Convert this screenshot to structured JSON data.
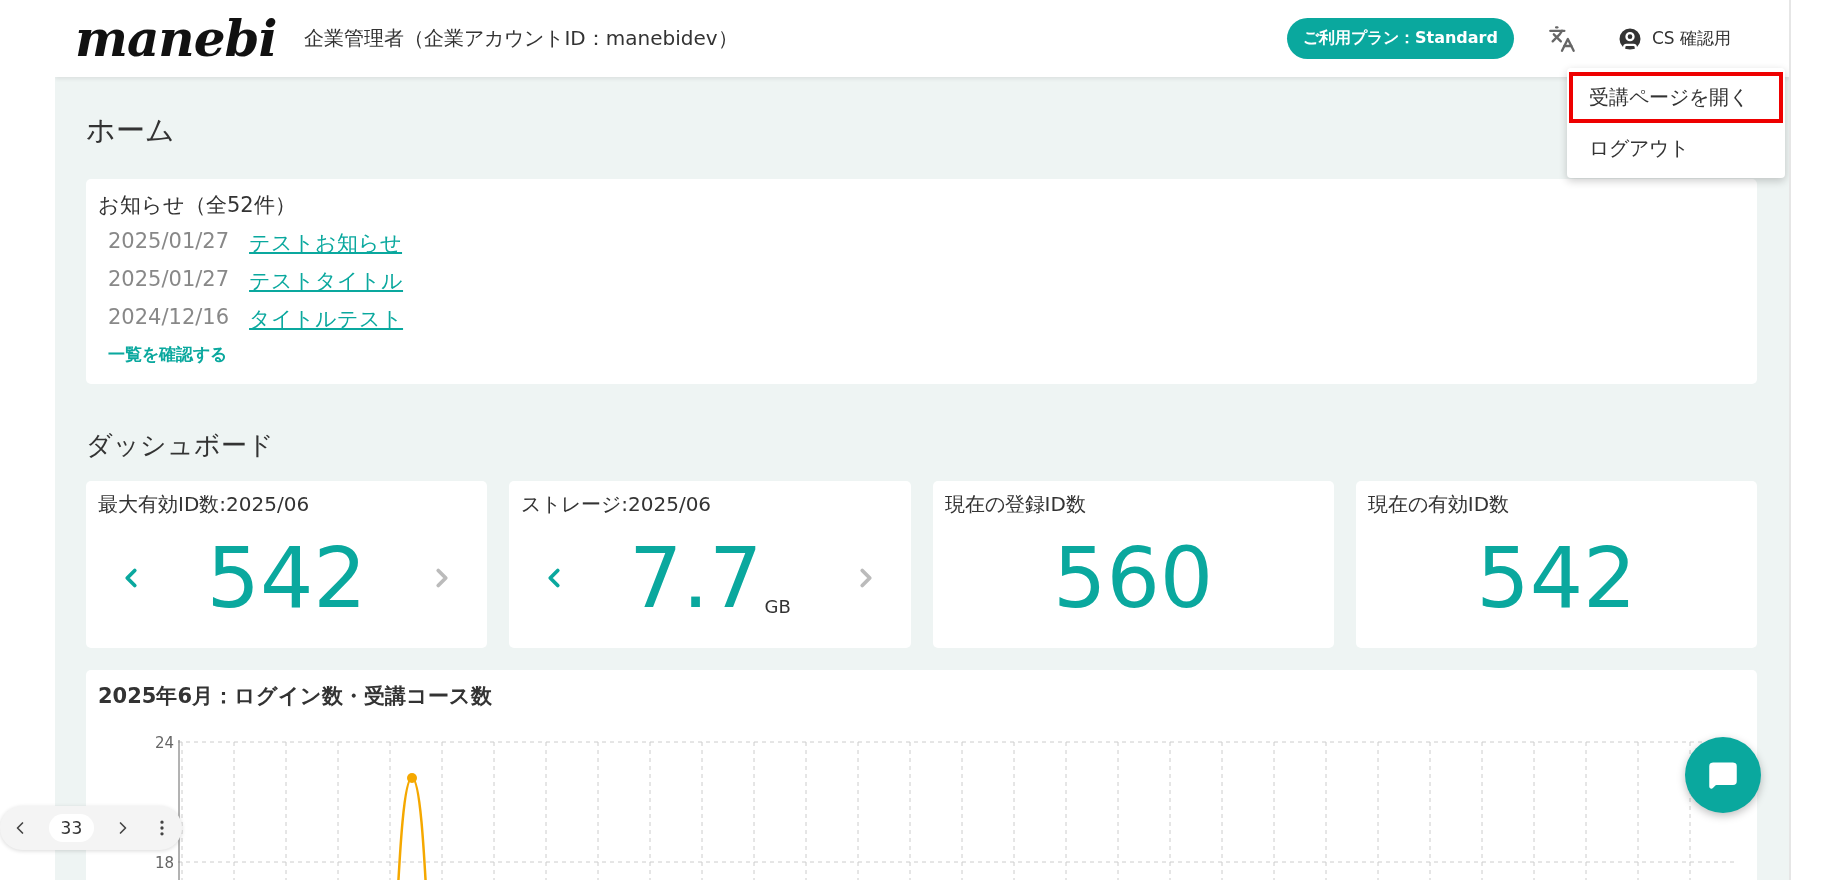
{
  "header": {
    "logo": "manebi",
    "role": "企業管理者（企業アカウントID：manebidev）",
    "plan": "ご利用プラン：Standard",
    "user": "CS 確認用"
  },
  "user_menu": [
    {
      "label": "受講ページを開く",
      "selected": true
    },
    {
      "label": "ログアウト",
      "selected": false
    }
  ],
  "page_title": "ホーム",
  "notices": {
    "title": "お知らせ（全52件）",
    "items": [
      {
        "date": "2025/01/27",
        "title": "テストお知らせ"
      },
      {
        "date": "2025/01/27",
        "title": "テストタイトル"
      },
      {
        "date": "2024/12/16",
        "title": "タイトルテスト"
      }
    ],
    "more_link": "一覧を確認する"
  },
  "dashboard": {
    "title": "ダッシュボード",
    "cards": [
      {
        "kind": "nav",
        "label": "最大有効ID数:2025/06",
        "value": "542",
        "prev_disabled": false,
        "next_disabled": true
      },
      {
        "kind": "nav",
        "label": "ストレージ:2025/06",
        "value": "7.7",
        "unit": "GB",
        "prev_disabled": false,
        "next_disabled": true
      },
      {
        "kind": "plain",
        "label": "現在の登録ID数",
        "value": "560"
      },
      {
        "kind": "plain",
        "label": "現在の有効ID数",
        "value": "542"
      }
    ]
  },
  "chart": {
    "title": "2025年6月：ログイン数・受講コース数",
    "y_tick_labels": [
      "24",
      "18"
    ]
  },
  "pager": {
    "page": "33"
  }
}
